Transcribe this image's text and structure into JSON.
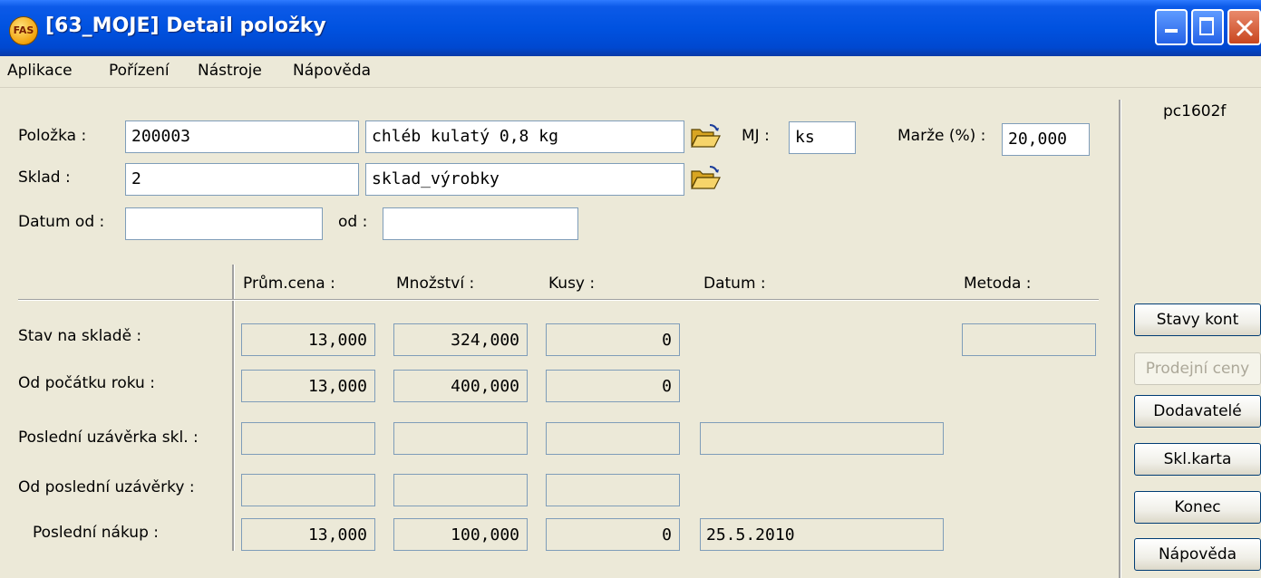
{
  "window": {
    "title": "[63_MOJE] Detail položky",
    "app_icon_text": "FAS"
  },
  "menu": [
    "Aplikace",
    "Pořízení",
    "Nástroje",
    "Nápověda"
  ],
  "header": {
    "item_label": "Položka :",
    "item_code": "200003",
    "item_name": "chléb kulatý 0,8 kg",
    "mj_label": "MJ :",
    "mj_value": "ks",
    "margin_label": "Marže (%) :",
    "margin_value": "20,000",
    "warehouse_label": "Sklad :",
    "warehouse_code": "2",
    "warehouse_name": "sklad_výrobky",
    "date_from_label": "Datum od :",
    "date_from_value": "",
    "date_to_label": "od :",
    "date_to_value": "",
    "computer_name": "pc1602f"
  },
  "grid": {
    "columns": [
      "Prům.cena :",
      "Množství :",
      "Kusy :",
      "Datum :",
      "Metoda :"
    ],
    "rows": [
      {
        "label": "Stav na skladě :",
        "price": "13,000",
        "qty": "324,000",
        "pieces": "0",
        "method": ""
      },
      {
        "label": "Od počátku roku :",
        "price": "13,000",
        "qty": "400,000",
        "pieces": "0"
      },
      {
        "label": "Poslední uzávěrka skl. :",
        "price": "",
        "qty": "",
        "pieces": "",
        "date": ""
      },
      {
        "label": "Od poslední uzávěrky :",
        "price": "",
        "qty": "",
        "pieces": ""
      },
      {
        "label": "Poslední nákup :",
        "price": "13,000",
        "qty": "100,000",
        "pieces": "0",
        "date": "25.5.2010"
      }
    ]
  },
  "buttons": [
    {
      "label": "Stavy kont",
      "enabled": true
    },
    {
      "label": "Prodejní ceny",
      "enabled": false
    },
    {
      "label": "Dodavatelé",
      "enabled": true
    },
    {
      "label": "Skl.karta",
      "enabled": true
    },
    {
      "label": "Konec",
      "enabled": true
    },
    {
      "label": "Nápověda",
      "enabled": true
    }
  ]
}
